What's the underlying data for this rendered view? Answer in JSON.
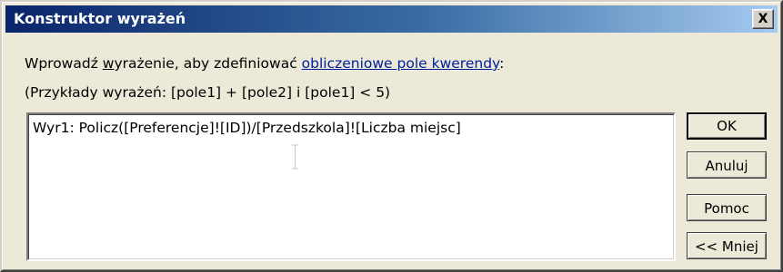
{
  "window": {
    "title": "Konstruktor wyrażeń",
    "close_label": "X"
  },
  "description": {
    "part1": "Wprowadź ",
    "underlined": "w",
    "part2": "yrażenie, aby zdefiniować ",
    "link": "obliczeniowe pole kwerendy",
    "part3": ":"
  },
  "examples": "(Przykłady wyrażeń: [pole1] + [pole2] i [pole1] < 5)",
  "expression": {
    "value": "Wyr1: Policz([Preferencje]![ID])/[Przedszkola]![Liczba miejsc]"
  },
  "buttons": {
    "ok": "OK",
    "cancel": "Anuluj",
    "help": "Pomoc",
    "less": "<< Mniej"
  }
}
